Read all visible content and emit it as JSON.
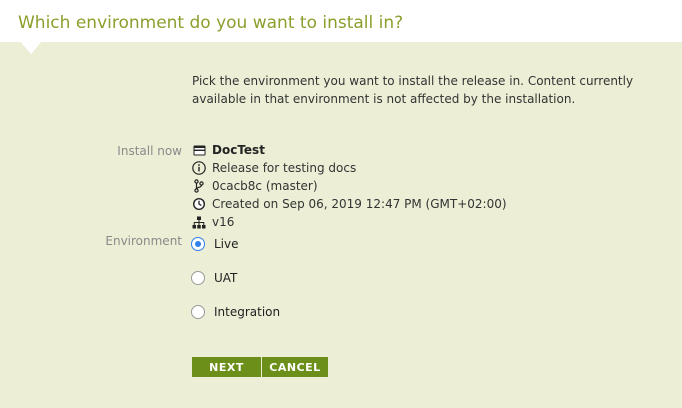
{
  "header": {
    "title": "Which environment do you want to install in?"
  },
  "intro_text": "Pick the environment you want to install the release in. Content currently available in that environment is not affected by the installation.",
  "install": {
    "label": "Install now",
    "release_name": "DocTest",
    "description": "Release for testing docs",
    "commit": "0cacb8c (master)",
    "created": "Created on Sep 06, 2019 12:47 PM (GMT+02:00)",
    "version": "v16"
  },
  "environment": {
    "label": "Environment",
    "options": [
      {
        "label": "Live",
        "selected": true
      },
      {
        "label": "UAT",
        "selected": false
      },
      {
        "label": "Integration",
        "selected": false
      }
    ]
  },
  "actions": {
    "next_label": "NEXT",
    "cancel_label": "CANCEL"
  },
  "colors": {
    "background": "#ecefd6",
    "header_text": "#8a9f2c",
    "button": "#6c8f1a",
    "radio_selected": "#2f80ed"
  },
  "icons": {
    "release": "card-icon",
    "description": "info-icon",
    "commit": "branch-icon",
    "created": "clock-icon",
    "version": "sitemap-icon"
  }
}
